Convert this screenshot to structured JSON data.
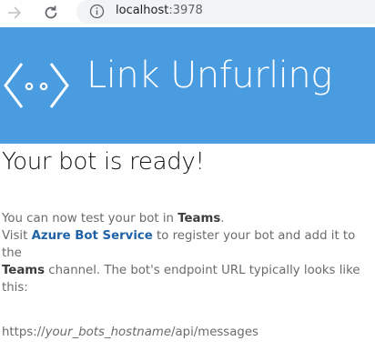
{
  "browser": {
    "url_host": "localhost",
    "url_port": ":3978"
  },
  "banner": {
    "title": "Link Unfurling",
    "logo_icon": "link-unfurl-icon",
    "background_color": "#4a9ce1"
  },
  "page": {
    "heading": "Your bot is ready!",
    "line1_prefix": "You can now test your bot in ",
    "line1_bold": "Teams",
    "line1_suffix": ".",
    "line2_prefix": "Visit ",
    "line2_link": "Azure Bot Service",
    "line2_suffix": " to register your bot and add it to the",
    "line3_bold": "Teams",
    "line3_suffix": " channel. The bot's endpoint URL typically looks like this:",
    "endpoint_prefix": "https://",
    "endpoint_italic": "your_bots_hostname",
    "endpoint_suffix": "/api/messages"
  },
  "icons": {
    "forward": "arrow-forward-icon",
    "reload": "reload-icon",
    "info": "info-icon"
  }
}
